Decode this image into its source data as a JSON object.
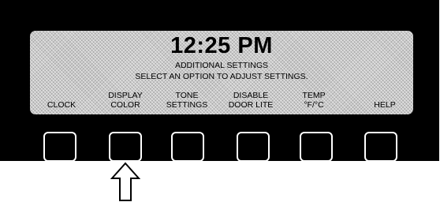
{
  "display": {
    "time": "12:25 PM",
    "line1": "ADDITIONAL SETTINGS",
    "line2": "SELECT AN OPTION TO ADJUST SETTINGS."
  },
  "options": [
    {
      "line1": "",
      "line2": "CLOCK"
    },
    {
      "line1": "DISPLAY",
      "line2": "COLOR"
    },
    {
      "line1": "TONE",
      "line2": "SETTINGS"
    },
    {
      "line1": "DISABLE",
      "line2": "DOOR LITE"
    },
    {
      "line1": "TEMP",
      "line2": "°F/°C"
    },
    {
      "line1": "",
      "line2": "HELP"
    }
  ],
  "indicator": {
    "target": "DISPLAY COLOR",
    "icon": "up-arrow-icon"
  }
}
